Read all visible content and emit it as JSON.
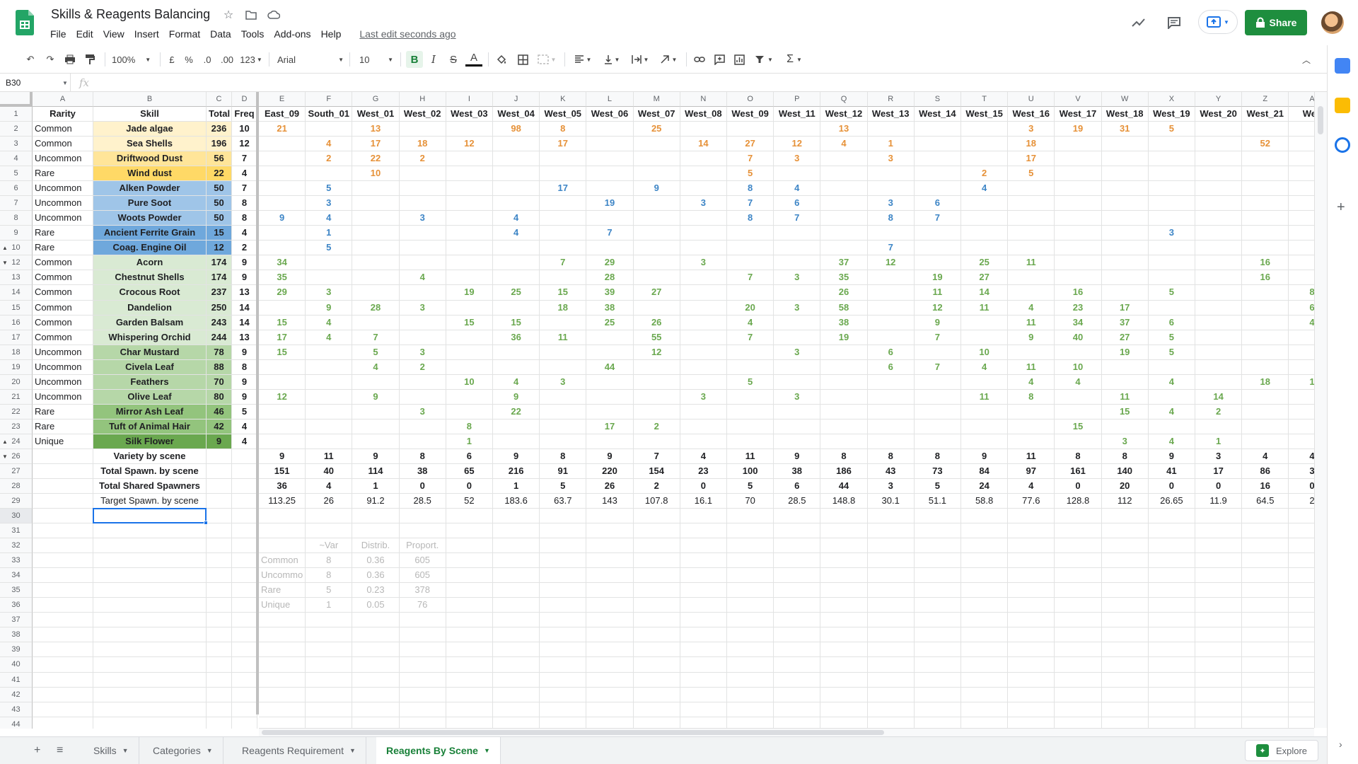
{
  "app": {
    "title": "Skills & Reagents Balancing",
    "menus": [
      "File",
      "Edit",
      "View",
      "Insert",
      "Format",
      "Data",
      "Tools",
      "Add-ons",
      "Help"
    ],
    "last_edit": "Last edit seconds ago",
    "share_label": "Share"
  },
  "toolbar": {
    "zoom": "100%",
    "currency": "£",
    "percent": "%",
    "dec_less": ".0",
    "dec_more": ".00",
    "more_formats": "123",
    "font": "Arial",
    "font_size": "10",
    "bold": "B",
    "italic": "I",
    "strike": "S",
    "text_color": "A",
    "function": "Σ"
  },
  "formula_bar": {
    "cell_ref": "B30",
    "fx": "fx",
    "value": ""
  },
  "colors": {
    "accent": "#1a73e8",
    "brand": "#1e8e3e",
    "green_text": "#6aa84f",
    "orange_text": "#e69138",
    "blue_text": "#3d85c6"
  },
  "grid": {
    "columns": [
      "A",
      "B",
      "C",
      "D",
      "E",
      "F",
      "G",
      "H",
      "I",
      "J",
      "K",
      "L",
      "M",
      "N",
      "O",
      "P",
      "Q",
      "R",
      "S",
      "T",
      "U",
      "V",
      "W",
      "X",
      "Y",
      "Z",
      "A"
    ],
    "rows": [
      {
        "n": "1",
        "grp": "",
        "A": "Rarity",
        "B": "Skill",
        "C": "Total",
        "D": "Freq",
        "hdr": true,
        "scenes": [
          "East_09",
          "South_01",
          "West_01",
          "West_02",
          "West_03",
          "West_04",
          "West_05",
          "West_06",
          "West_07",
          "West_08",
          "West_09",
          "West_11",
          "West_12",
          "West_13",
          "West_14",
          "West_15",
          "West_16",
          "West_17",
          "West_18",
          "West_19",
          "West_20",
          "West_21",
          "Wes"
        ]
      },
      {
        "n": "2",
        "grp": "",
        "A": "Common",
        "B": "Jade algae",
        "C": "236",
        "D": "10",
        "bg": "#fff2cc",
        "tc": "o",
        "scenes": [
          "21",
          "",
          "13",
          "",
          "",
          "98",
          "8",
          "",
          "25",
          "",
          "",
          "",
          "13",
          "",
          "",
          "",
          "3",
          "19",
          "31",
          "5",
          "",
          "",
          ""
        ]
      },
      {
        "n": "3",
        "grp": "",
        "A": "Common",
        "B": "Sea Shells",
        "C": "196",
        "D": "12",
        "bg": "#fff2cc",
        "tc": "o",
        "scenes": [
          "",
          "4",
          "17",
          "18",
          "12",
          "",
          "17",
          "",
          "",
          "14",
          "27",
          "12",
          "4",
          "1",
          "",
          "",
          "18",
          "",
          "",
          "",
          "",
          "52",
          ""
        ]
      },
      {
        "n": "4",
        "grp": "",
        "A": "Uncommon",
        "B": "Driftwood Dust",
        "C": "56",
        "D": "7",
        "bg": "#ffe599",
        "tc": "o",
        "scenes": [
          "",
          "2",
          "22",
          "2",
          "",
          "",
          "",
          "",
          "",
          "",
          "7",
          "3",
          "",
          "3",
          "",
          "",
          "17",
          "",
          "",
          "",
          "",
          "",
          ""
        ]
      },
      {
        "n": "5",
        "grp": "",
        "A": "Rare",
        "B": "Wind dust",
        "C": "22",
        "D": "4",
        "bg": "#ffd966",
        "tc": "o",
        "scenes": [
          "",
          "",
          "10",
          "",
          "",
          "",
          "",
          "",
          "",
          "",
          "5",
          "",
          "",
          "",
          "",
          "2",
          "5",
          "",
          "",
          "",
          "",
          "",
          ""
        ]
      },
      {
        "n": "6",
        "grp": "",
        "A": "Uncommon",
        "B": "Alken Powder",
        "C": "50",
        "D": "7",
        "bg": "#9fc5e8",
        "tc": "bl",
        "scenes": [
          "",
          "5",
          "",
          "",
          "",
          "",
          "17",
          "",
          "9",
          "",
          "8",
          "4",
          "",
          "",
          "",
          "4",
          "",
          "",
          "",
          "",
          "",
          "",
          ""
        ]
      },
      {
        "n": "7",
        "grp": "",
        "A": "Uncommon",
        "B": "Pure Soot",
        "C": "50",
        "D": "8",
        "bg": "#9fc5e8",
        "tc": "bl",
        "scenes": [
          "",
          "3",
          "",
          "",
          "",
          "",
          "",
          "19",
          "",
          "3",
          "7",
          "6",
          "",
          "3",
          "6",
          "",
          "",
          "",
          "",
          "",
          "",
          "",
          ""
        ]
      },
      {
        "n": "8",
        "grp": "",
        "A": "Uncommon",
        "B": "Woots Powder",
        "C": "50",
        "D": "8",
        "bg": "#9fc5e8",
        "tc": "bl",
        "scenes": [
          "9",
          "4",
          "",
          "3",
          "",
          "4",
          "",
          "",
          "",
          "",
          "8",
          "7",
          "",
          "8",
          "7",
          "",
          "",
          "",
          "",
          "",
          "",
          "",
          ""
        ]
      },
      {
        "n": "9",
        "grp": "",
        "A": "Rare",
        "B": "Ancient Ferrite Grain",
        "C": "15",
        "D": "4",
        "bg": "#6fa8dc",
        "tc": "bl",
        "scenes": [
          "",
          "1",
          "",
          "",
          "",
          "4",
          "",
          "7",
          "",
          "",
          "",
          "",
          "",
          "",
          "",
          "",
          "",
          "",
          "",
          "3",
          "",
          "",
          ""
        ]
      },
      {
        "n": "10",
        "grp": "▲",
        "A": "Rare",
        "B": "Coag. Engine Oil",
        "C": "12",
        "D": "2",
        "bg": "#6fa8dc",
        "tc": "bl",
        "scenes": [
          "",
          "5",
          "",
          "",
          "",
          "",
          "",
          "",
          "",
          "",
          "",
          "",
          "",
          "7",
          "",
          "",
          "",
          "",
          "",
          "",
          "",
          "",
          ""
        ]
      },
      {
        "n": "12",
        "grp": "▼",
        "A": "Common",
        "B": "Acorn",
        "C": "174",
        "D": "9",
        "bg": "#d9ead3",
        "tc": "g",
        "scenes": [
          "34",
          "",
          "",
          "",
          "",
          "",
          "7",
          "29",
          "",
          "3",
          "",
          "",
          "37",
          "12",
          "",
          "25",
          "11",
          "",
          "",
          "",
          "",
          "16",
          ""
        ]
      },
      {
        "n": "13",
        "grp": "",
        "A": "Common",
        "B": "Chestnut Shells",
        "C": "174",
        "D": "9",
        "bg": "#d9ead3",
        "tc": "g",
        "scenes": [
          "35",
          "",
          "",
          "4",
          "",
          "",
          "",
          "28",
          "",
          "",
          "7",
          "3",
          "35",
          "",
          "19",
          "27",
          "",
          "",
          "",
          "",
          "",
          "16",
          ""
        ]
      },
      {
        "n": "14",
        "grp": "",
        "A": "Common",
        "B": "Crocous Root",
        "C": "237",
        "D": "13",
        "bg": "#d9ead3",
        "tc": "g",
        "scenes": [
          "29",
          "3",
          "",
          "",
          "19",
          "25",
          "15",
          "39",
          "27",
          "",
          "",
          "",
          "26",
          "",
          "11",
          "14",
          "",
          "16",
          "",
          "5",
          "",
          "",
          "8"
        ]
      },
      {
        "n": "15",
        "grp": "",
        "A": "Common",
        "B": "Dandelion",
        "C": "250",
        "D": "14",
        "bg": "#d9ead3",
        "tc": "g",
        "scenes": [
          "",
          "9",
          "28",
          "3",
          "",
          "",
          "18",
          "38",
          "",
          "",
          "20",
          "3",
          "58",
          "",
          "12",
          "11",
          "4",
          "23",
          "17",
          "",
          "",
          "",
          "6"
        ]
      },
      {
        "n": "16",
        "grp": "",
        "A": "Common",
        "B": "Garden Balsam",
        "C": "243",
        "D": "14",
        "bg": "#d9ead3",
        "tc": "g",
        "scenes": [
          "15",
          "4",
          "",
          "",
          "15",
          "15",
          "",
          "25",
          "26",
          "",
          "4",
          "",
          "38",
          "",
          "9",
          "",
          "11",
          "34",
          "37",
          "6",
          "",
          "",
          "4"
        ]
      },
      {
        "n": "17",
        "grp": "",
        "A": "Common",
        "B": "Whispering Orchid",
        "C": "244",
        "D": "13",
        "bg": "#d9ead3",
        "tc": "g",
        "scenes": [
          "17",
          "4",
          "7",
          "",
          "",
          "36",
          "11",
          "",
          "55",
          "",
          "7",
          "",
          "19",
          "",
          "7",
          "",
          "9",
          "40",
          "27",
          "5",
          "",
          "",
          ""
        ]
      },
      {
        "n": "18",
        "grp": "",
        "A": "Uncommon",
        "B": "Char Mustard",
        "C": "78",
        "D": "9",
        "bg": "#b6d7a8",
        "tc": "g",
        "scenes": [
          "15",
          "",
          "5",
          "3",
          "",
          "",
          "",
          "",
          "12",
          "",
          "",
          "3",
          "",
          "6",
          "",
          "10",
          "",
          "",
          "19",
          "5",
          "",
          "",
          ""
        ]
      },
      {
        "n": "19",
        "grp": "",
        "A": "Uncommon",
        "B": "Civela Leaf",
        "C": "88",
        "D": "8",
        "bg": "#b6d7a8",
        "tc": "g",
        "scenes": [
          "",
          "",
          "4",
          "2",
          "",
          "",
          "",
          "44",
          "",
          "",
          "",
          "",
          "",
          "6",
          "7",
          "4",
          "11",
          "10",
          "",
          "",
          "",
          "",
          ""
        ]
      },
      {
        "n": "20",
        "grp": "",
        "A": "Uncommon",
        "B": "Feathers",
        "C": "70",
        "D": "9",
        "bg": "#b6d7a8",
        "tc": "g",
        "scenes": [
          "",
          "",
          "",
          "",
          "10",
          "4",
          "3",
          "",
          "",
          "",
          "5",
          "",
          "",
          "",
          "",
          "",
          "4",
          "4",
          "",
          "4",
          "",
          "18",
          "1"
        ]
      },
      {
        "n": "21",
        "grp": "",
        "A": "Uncommon",
        "B": "Olive Leaf",
        "C": "80",
        "D": "9",
        "bg": "#b6d7a8",
        "tc": "g",
        "scenes": [
          "12",
          "",
          "9",
          "",
          "",
          "9",
          "",
          "",
          "",
          "3",
          "",
          "3",
          "",
          "",
          "",
          "11",
          "8",
          "",
          "11",
          "",
          "14",
          "",
          ""
        ]
      },
      {
        "n": "22",
        "grp": "",
        "A": "Rare",
        "B": "Mirror Ash Leaf",
        "C": "46",
        "D": "5",
        "bg": "#93c47d",
        "tc": "g",
        "scenes": [
          "",
          "",
          "",
          "3",
          "",
          "22",
          "",
          "",
          "",
          "",
          "",
          "",
          "",
          "",
          "",
          "",
          "",
          "",
          "15",
          "4",
          "2",
          "",
          ""
        ]
      },
      {
        "n": "23",
        "grp": "",
        "A": "Rare",
        "B": "Tuft of Animal Hair",
        "C": "42",
        "D": "4",
        "bg": "#93c47d",
        "tc": "g",
        "scenes": [
          "",
          "",
          "",
          "",
          "8",
          "",
          "",
          "17",
          "2",
          "",
          "",
          "",
          "",
          "",
          "",
          "",
          "",
          "15",
          "",
          "",
          "",
          "",
          ""
        ]
      },
      {
        "n": "24",
        "grp": "▲",
        "A": "Unique",
        "B": "Silk Flower",
        "C": "9",
        "D": "4",
        "bg": "#6aa84f",
        "tc": "g",
        "scenes": [
          "",
          "",
          "",
          "",
          "1",
          "",
          "",
          "",
          "",
          "",
          "",
          "",
          "",
          "",
          "",
          "",
          "",
          "",
          "3",
          "4",
          "1",
          "",
          ""
        ]
      },
      {
        "n": "26",
        "grp": "▼",
        "A": "",
        "B": "Variety by scene",
        "C": "",
        "D": "",
        "sum": true,
        "bold": true,
        "scenes": [
          "9",
          "11",
          "9",
          "8",
          "6",
          "9",
          "8",
          "9",
          "7",
          "4",
          "11",
          "9",
          "8",
          "8",
          "8",
          "9",
          "11",
          "8",
          "8",
          "9",
          "3",
          "4",
          "4"
        ]
      },
      {
        "n": "27",
        "grp": "",
        "A": "",
        "B": "Total Spawn. by scene",
        "C": "",
        "D": "",
        "sum": true,
        "bold": true,
        "scenes": [
          "151",
          "40",
          "114",
          "38",
          "65",
          "216",
          "91",
          "220",
          "154",
          "23",
          "100",
          "38",
          "186",
          "43",
          "73",
          "84",
          "97",
          "161",
          "140",
          "41",
          "17",
          "86",
          "3"
        ]
      },
      {
        "n": "28",
        "grp": "",
        "A": "",
        "B": "Total Shared Spawners",
        "C": "",
        "D": "",
        "sum": true,
        "bold": true,
        "scenes": [
          "36",
          "4",
          "1",
          "0",
          "0",
          "1",
          "5",
          "26",
          "2",
          "0",
          "5",
          "6",
          "44",
          "3",
          "5",
          "24",
          "4",
          "0",
          "20",
          "0",
          "0",
          "16",
          "0"
        ]
      },
      {
        "n": "29",
        "grp": "",
        "A": "",
        "B": "Target Spawn. by scene",
        "C": "",
        "D": "",
        "sum": true,
        "bold": false,
        "scenes": [
          "113.25",
          "26",
          "91.2",
          "28.5",
          "52",
          "183.6",
          "63.7",
          "143",
          "107.8",
          "16.1",
          "70",
          "28.5",
          "148.8",
          "30.1",
          "51.1",
          "58.8",
          "77.6",
          "128.8",
          "112",
          "26.65",
          "11.9",
          "64.5",
          "2"
        ]
      },
      {
        "n": "30",
        "grp": "",
        "A": "",
        "B": "",
        "C": "",
        "D": "",
        "scenes": []
      },
      {
        "n": "31",
        "grp": "",
        "A": "",
        "B": "",
        "C": "",
        "D": "",
        "scenes": []
      },
      {
        "n": "32",
        "grp": "",
        "A": "",
        "B": "",
        "C": "",
        "D": "",
        "dim": true,
        "scenes": [
          "",
          "~Var",
          "Distrib.",
          "Proport."
        ]
      },
      {
        "n": "33",
        "grp": "",
        "A": "",
        "B": "",
        "C": "",
        "D": "",
        "dim": true,
        "scenes": [
          "Common",
          "8",
          "0.36",
          "605"
        ]
      },
      {
        "n": "34",
        "grp": "",
        "A": "",
        "B": "",
        "C": "",
        "D": "",
        "dim": true,
        "scenes": [
          "Uncommo",
          "8",
          "0.36",
          "605"
        ]
      },
      {
        "n": "35",
        "grp": "",
        "A": "",
        "B": "",
        "C": "",
        "D": "",
        "dim": true,
        "scenes": [
          "Rare",
          "5",
          "0.23",
          "378"
        ]
      },
      {
        "n": "36",
        "grp": "",
        "A": "",
        "B": "",
        "C": "",
        "D": "",
        "dim": true,
        "scenes": [
          "Unique",
          "1",
          "0.05",
          "76"
        ]
      },
      {
        "n": "37",
        "scenes": []
      },
      {
        "n": "38",
        "scenes": []
      },
      {
        "n": "39",
        "scenes": []
      },
      {
        "n": "40",
        "scenes": []
      },
      {
        "n": "41",
        "scenes": []
      },
      {
        "n": "42",
        "scenes": []
      },
      {
        "n": "43",
        "scenes": []
      },
      {
        "n": "44",
        "scenes": []
      }
    ]
  },
  "sheet_tabs": [
    {
      "label": "Skills",
      "active": false
    },
    {
      "label": "Categories",
      "active": false
    },
    {
      "label": "Reagents Requirement",
      "active": false
    },
    {
      "label": "Reagents By Scene",
      "active": true
    }
  ],
  "explore_label": "Explore"
}
